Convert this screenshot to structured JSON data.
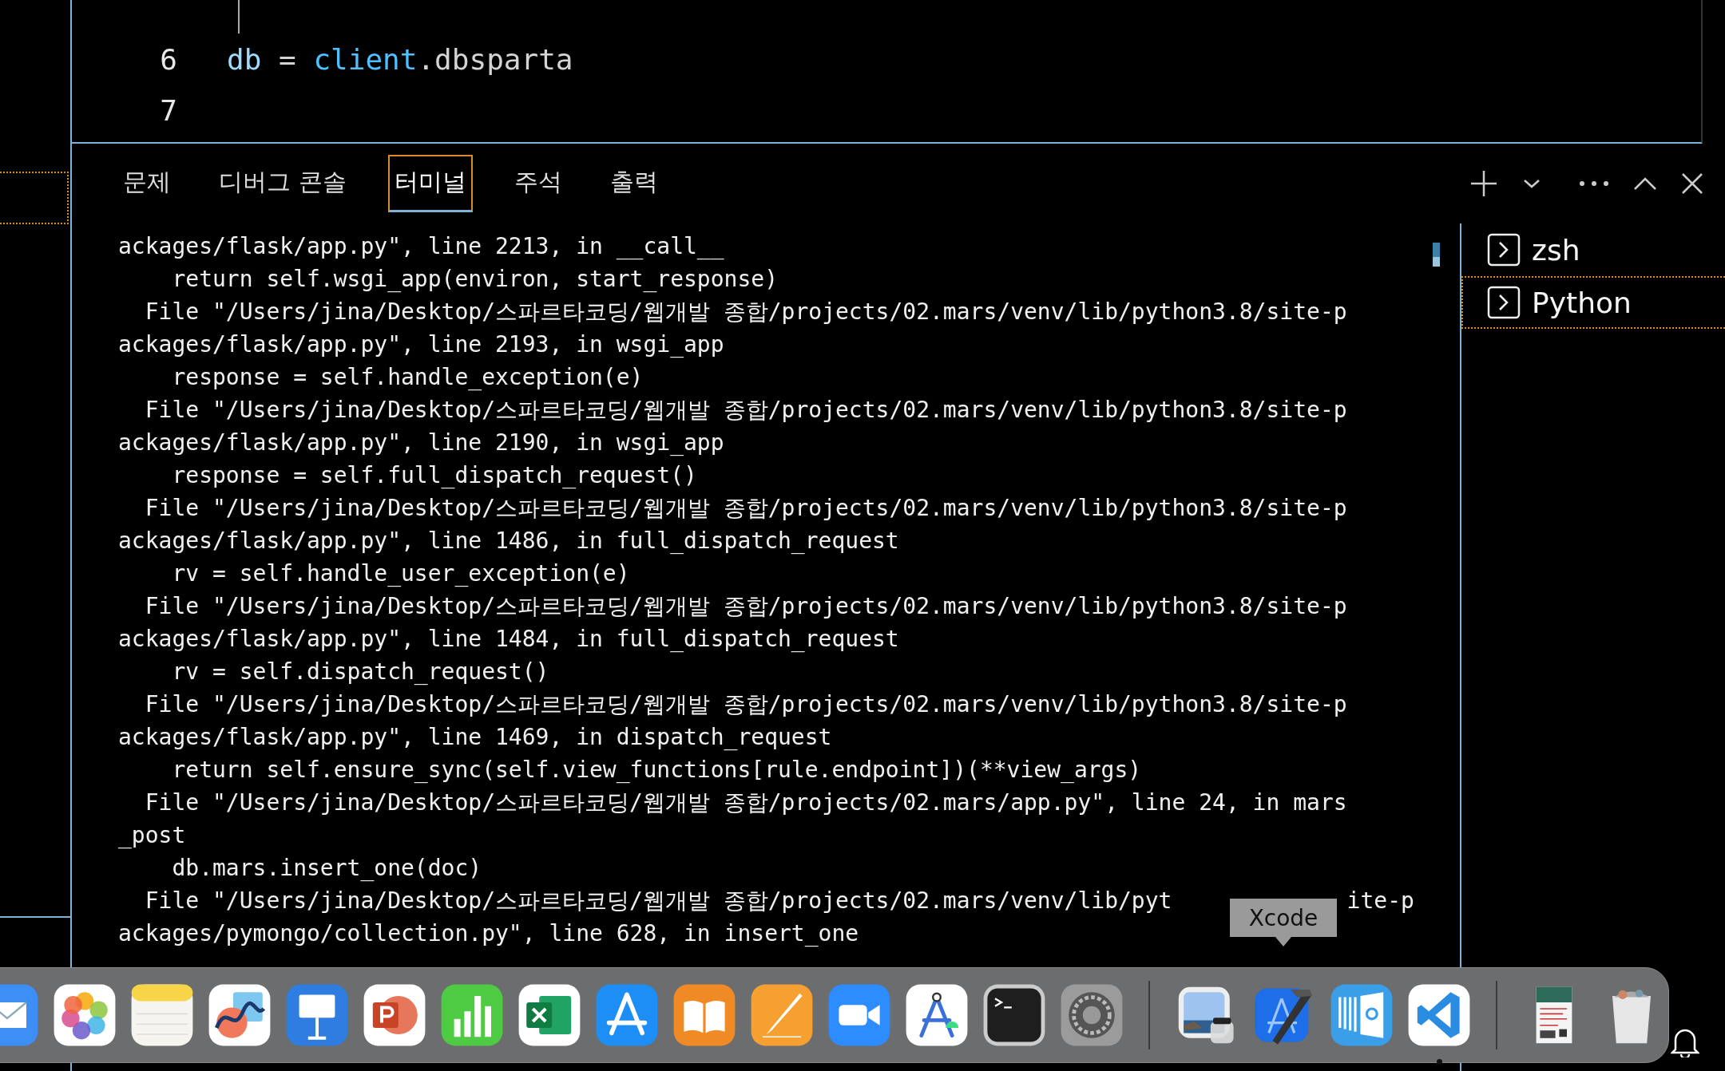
{
  "editor": {
    "lines": [
      {
        "number": "6",
        "tokens": [
          {
            "text": "db",
            "kind": "variable"
          },
          {
            "text": " = ",
            "kind": "plain"
          },
          {
            "text": "client",
            "kind": "object"
          },
          {
            "text": ".dbsparta",
            "kind": "plain"
          }
        ]
      },
      {
        "number": "7"
      }
    ]
  },
  "panel": {
    "tabs": [
      {
        "label": "문제",
        "selected": false
      },
      {
        "label": "디버그 콘솔",
        "selected": false
      },
      {
        "label": "터미널",
        "selected": true
      },
      {
        "label": "주석",
        "selected": false
      },
      {
        "label": "출력",
        "selected": false
      }
    ],
    "terminal_lines": [
      "ackages/flask/app.py\", line 2213, in __call__",
      "    return self.wsgi_app(environ, start_response)",
      "  File \"/Users/jina/Desktop/스파르타코딩/웹개발 종합/projects/02.mars/venv/lib/python3.8/site-p",
      "ackages/flask/app.py\", line 2193, in wsgi_app",
      "    response = self.handle_exception(e)",
      "  File \"/Users/jina/Desktop/스파르타코딩/웹개발 종합/projects/02.mars/venv/lib/python3.8/site-p",
      "ackages/flask/app.py\", line 2190, in wsgi_app",
      "    response = self.full_dispatch_request()",
      "  File \"/Users/jina/Desktop/스파르타코딩/웹개발 종합/projects/02.mars/venv/lib/python3.8/site-p",
      "ackages/flask/app.py\", line 1486, in full_dispatch_request",
      "    rv = self.handle_user_exception(e)",
      "  File \"/Users/jina/Desktop/스파르타코딩/웹개발 종합/projects/02.mars/venv/lib/python3.8/site-p",
      "ackages/flask/app.py\", line 1484, in full_dispatch_request",
      "    rv = self.dispatch_request()",
      "  File \"/Users/jina/Desktop/스파르타코딩/웹개발 종합/projects/02.mars/venv/lib/python3.8/site-p",
      "ackages/flask/app.py\", line 1469, in dispatch_request",
      "    return self.ensure_sync(self.view_functions[rule.endpoint])(**view_args)",
      "  File \"/Users/jina/Desktop/스파르타코딩/웹개발 종합/projects/02.mars/app.py\", line 24, in mars",
      "_post",
      "    db.mars.insert_one(doc)",
      {
        "text": "  File \"/Users/jina/Desktop/스파르타코딩/웹개발 종합/projects/02.mars/venv/lib/pyt",
        "tail": "ite-p"
      },
      "ackages/pymongo/collection.py\", line 628, in insert_one"
    ],
    "terminals": [
      {
        "name": "zsh",
        "selected": false
      },
      {
        "name": "Python",
        "selected": true
      }
    ]
  },
  "dock": {
    "tooltip": "Xcode",
    "items": [
      {
        "running": false
      },
      {
        "running": false
      },
      {
        "running": false
      },
      {
        "running": false
      },
      {
        "running": false
      },
      {
        "running": false
      },
      {
        "running": false
      },
      {
        "running": false
      },
      {
        "running": false
      },
      {
        "running": false
      },
      {
        "running": false
      },
      {
        "running": false
      },
      {
        "running": false
      },
      {
        "running": false
      },
      {
        "running": false
      },
      {
        "running": false
      },
      {
        "running": false
      },
      {
        "running": false
      },
      {
        "running": true
      },
      {
        "running": false
      },
      {
        "running": false
      }
    ]
  }
}
